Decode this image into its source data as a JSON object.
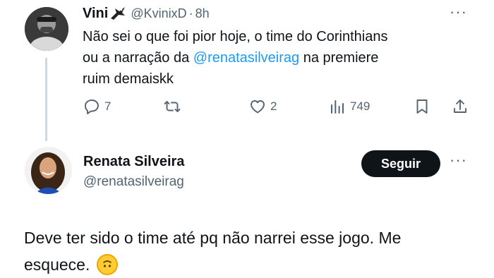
{
  "tweet1": {
    "author_name": "Vini",
    "author_handle": "@KvinixD",
    "separator": "·",
    "time": "8h",
    "body_part1": "Não sei o que foi pior hoje, o time do Corinthians",
    "body_part2_prefix": "ou a narração da ",
    "body_mention": "@renatasilveirag",
    "body_part2_suffix": " na premiere",
    "body_part3": "ruim demaiskk",
    "actions": {
      "reply_count": "7",
      "retweet_count": "",
      "like_count": "2",
      "views_count": "749"
    },
    "more_icon": "ellipsis-icon"
  },
  "tweet2": {
    "author_name": "Renata Silveira",
    "author_handle": "@renatasilveirag",
    "follow_label": "Seguir",
    "body_line1": "Deve ter sido o time até pq não narrei esse jogo. Me",
    "body_line2": "esquece.",
    "emoji_icon": "upside-down-face-icon"
  },
  "colors": {
    "accent": "#1d9bf0",
    "text": "#0f1419",
    "muted": "#536471",
    "follow_bg": "#0f1419"
  }
}
